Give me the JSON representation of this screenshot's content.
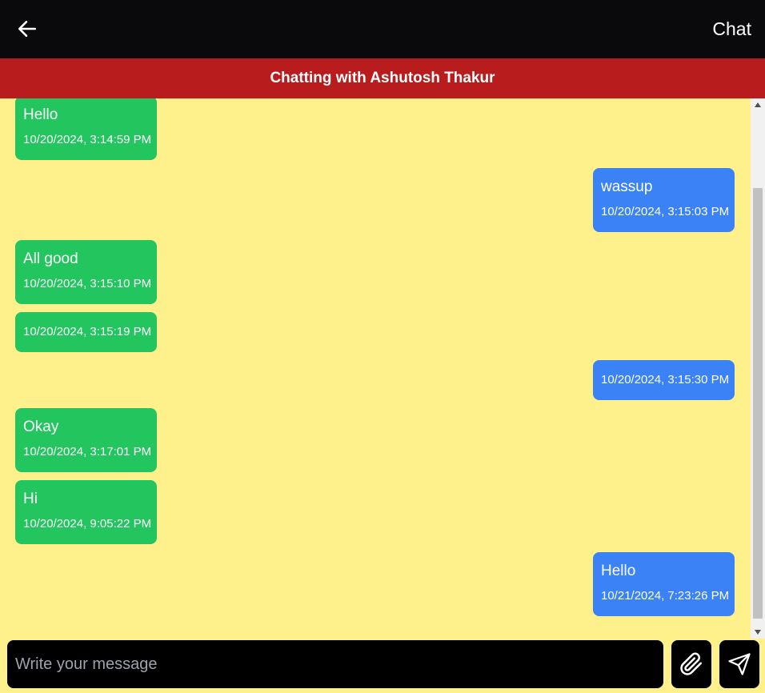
{
  "topbar": {
    "title": "Chat",
    "back_icon": "arrow-left-icon"
  },
  "header": {
    "title": "Chatting with Ashutosh Thakur",
    "color": "#b91c1c"
  },
  "colors": {
    "background": "#fef08a",
    "received": "#22c55e",
    "sent": "#3b82f6",
    "topbar": "#0a0a0d"
  },
  "messages": [
    {
      "direction": "received",
      "text": "Hello",
      "time": "10/20/2024, 3:14:59 PM"
    },
    {
      "direction": "sent",
      "text": "wassup",
      "time": "10/20/2024, 3:15:03 PM"
    },
    {
      "direction": "received",
      "text": "All good",
      "time": "10/20/2024, 3:15:10 PM"
    },
    {
      "direction": "received",
      "text": "",
      "time": "10/20/2024, 3:15:19 PM"
    },
    {
      "direction": "sent",
      "text": "",
      "time": "10/20/2024, 3:15:30 PM"
    },
    {
      "direction": "received",
      "text": "Okay",
      "time": "10/20/2024, 3:17:01 PM"
    },
    {
      "direction": "received",
      "text": "Hi",
      "time": "10/20/2024, 9:05:22 PM"
    },
    {
      "direction": "sent",
      "text": "Hello",
      "time": "10/21/2024, 7:23:26 PM"
    }
  ],
  "composer": {
    "placeholder": "Write your message",
    "value": "",
    "attach_icon": "paperclip-icon",
    "send_icon": "send-icon"
  }
}
